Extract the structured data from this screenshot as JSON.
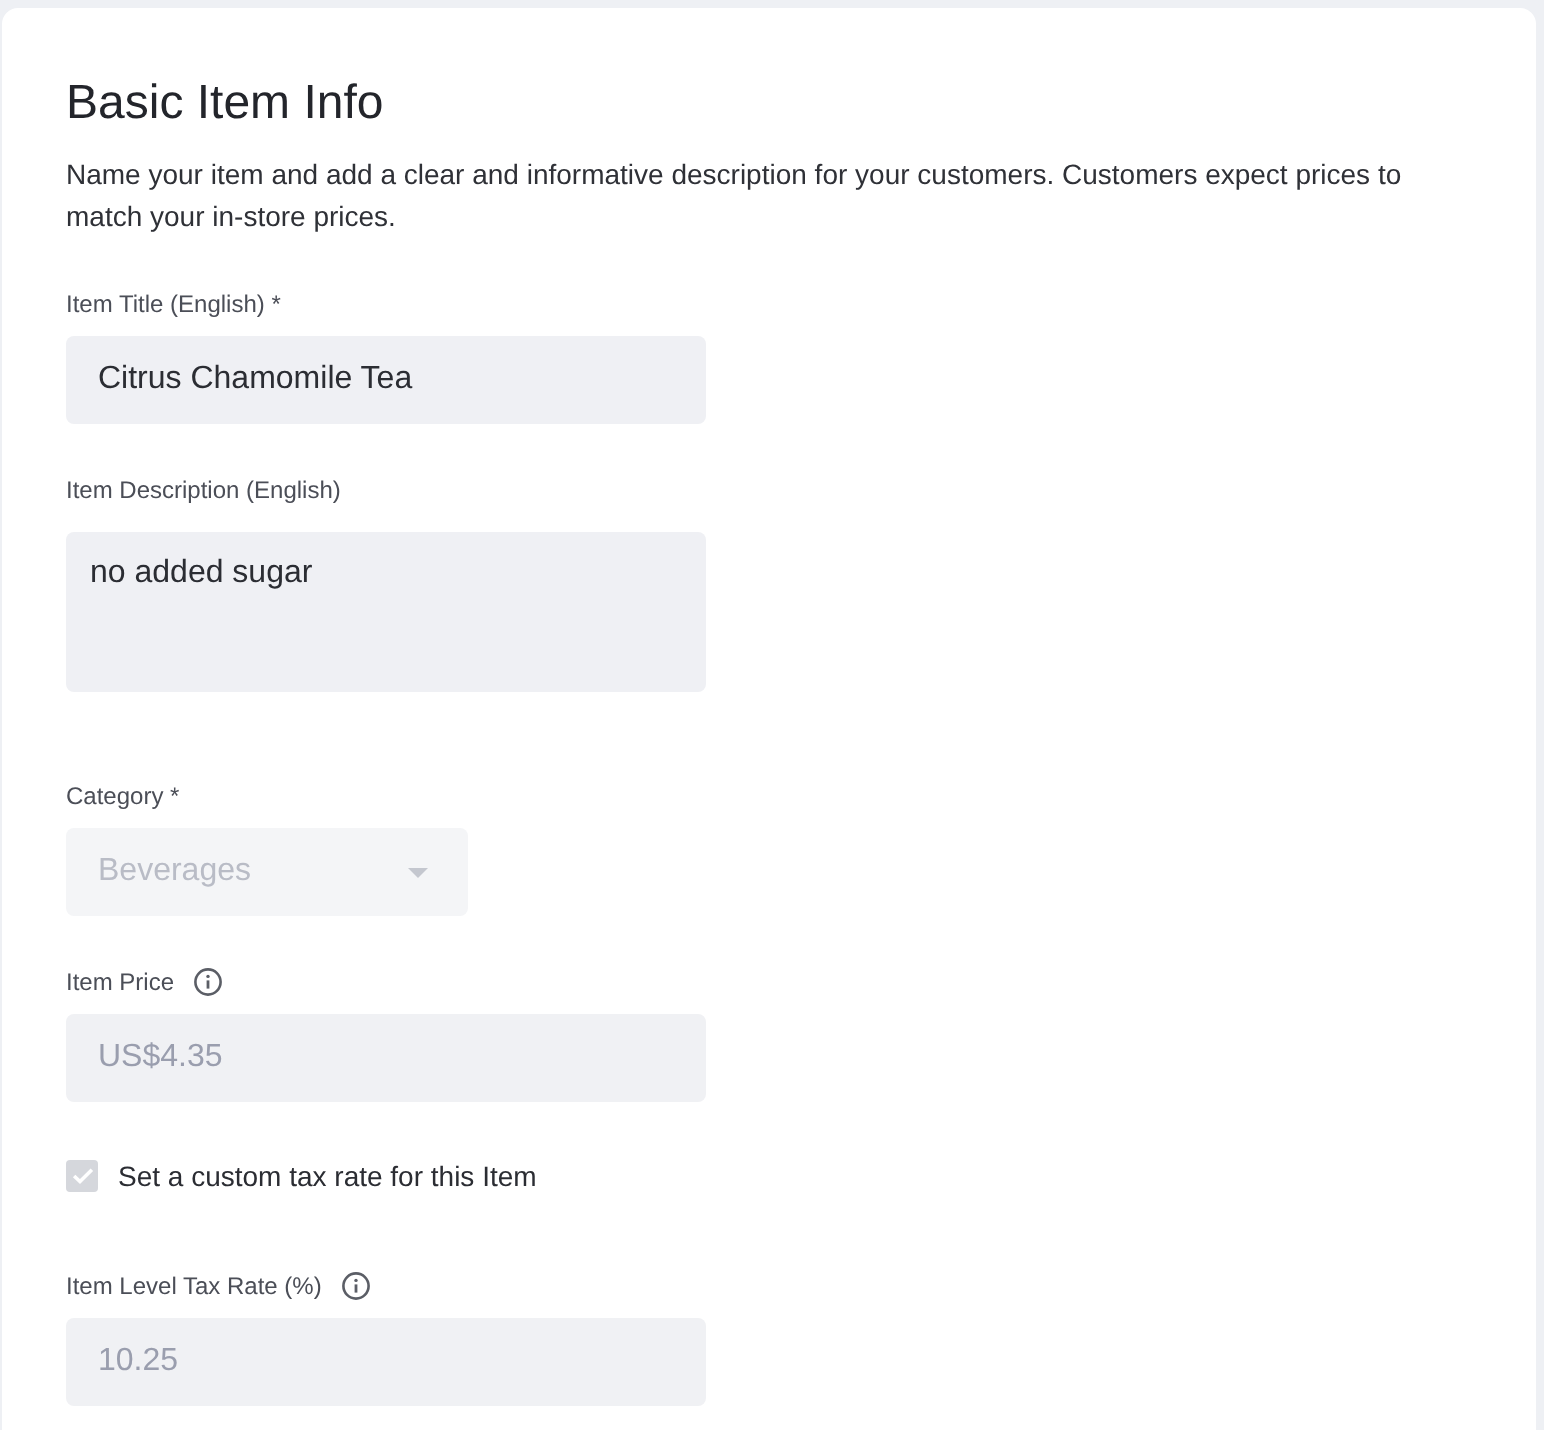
{
  "section": {
    "title": "Basic Item Info",
    "description": "Name your item and add a clear and informative description for your customers. Customers expect prices to match your in-store prices."
  },
  "fields": [
    {
      "kind": "text",
      "label": "Item Title (English) *",
      "info_icon": false,
      "value": "Citrus Chamomile Tea",
      "disabled": false
    },
    {
      "kind": "textarea",
      "label": "Item Description (English)",
      "info_icon": false,
      "value": "no added sugar",
      "disabled": false
    },
    {
      "kind": "select",
      "label": "Category *",
      "info_icon": false,
      "value": "Beverages",
      "disabled": true
    },
    {
      "kind": "text",
      "label": "Item Price",
      "info_icon": true,
      "value": "US$4.35",
      "disabled": true
    },
    {
      "kind": "checkbox",
      "label": "Set a custom tax rate for this Item",
      "checked": true,
      "disabled": true
    },
    {
      "kind": "text",
      "label": "Item Level Tax Rate (%)",
      "info_icon": true,
      "value": "10.25",
      "disabled": true
    }
  ]
}
